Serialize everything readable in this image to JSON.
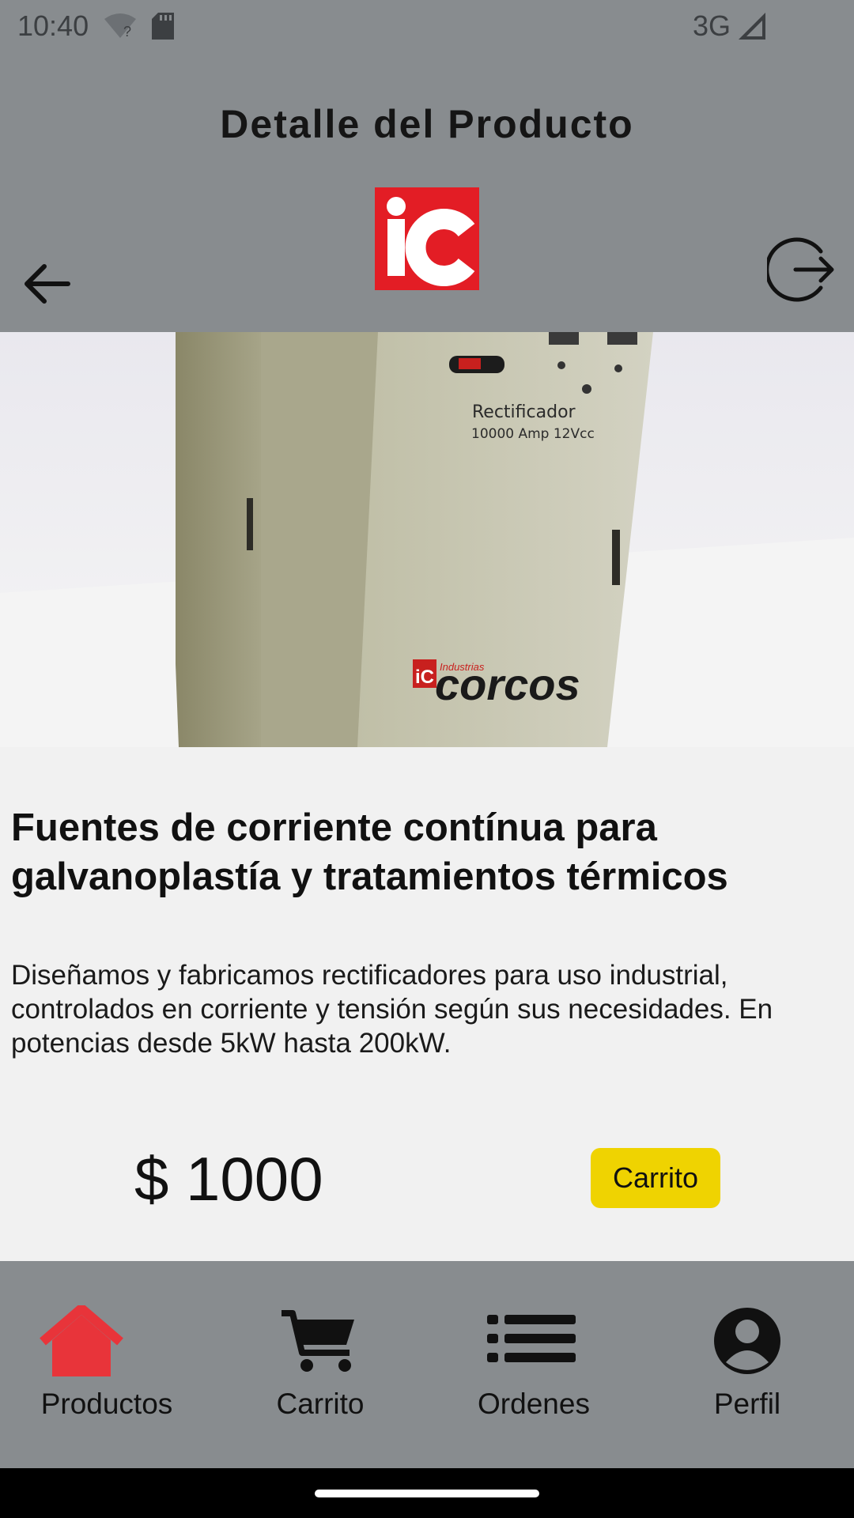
{
  "status_bar": {
    "time": "10:40",
    "network": "3G",
    "wifi_icon": "wifi-icon",
    "sd_icon": "sd-card-icon",
    "signal_icon": "signal-icon"
  },
  "header": {
    "title": "Detalle del Producto",
    "logo_text": "iC",
    "back_icon": "arrow-left-icon",
    "logout_icon": "logout-icon",
    "color": "#888c8f"
  },
  "product": {
    "image_labels": {
      "line1": "Rectificador",
      "line2": "10000 Amp 12Vcc",
      "brand_small": "Industrias",
      "brand": "corcos",
      "brand_logo": "iC"
    },
    "title": "Fuentes de corriente contínua para galvanoplastía y tratamientos térmicos",
    "description": "Diseñamos y fabricamos rectificadores para uso industrial, controlados en corriente y tensión según sus necesidades. En potencias desde 5kW hasta 200kW.",
    "price": "$ 1000",
    "cart_button": "Carrito"
  },
  "bottom_nav": {
    "items": [
      {
        "label": "Productos",
        "icon": "home-icon",
        "active": true
      },
      {
        "label": "Carrito",
        "icon": "cart-icon",
        "active": false
      },
      {
        "label": "Ordenes",
        "icon": "list-icon",
        "active": false
      },
      {
        "label": "Perfil",
        "icon": "user-icon",
        "active": false
      }
    ]
  },
  "colors": {
    "accent_active": "#e8343a",
    "cart_button": "#efd301",
    "logo_red": "#e31d25"
  }
}
